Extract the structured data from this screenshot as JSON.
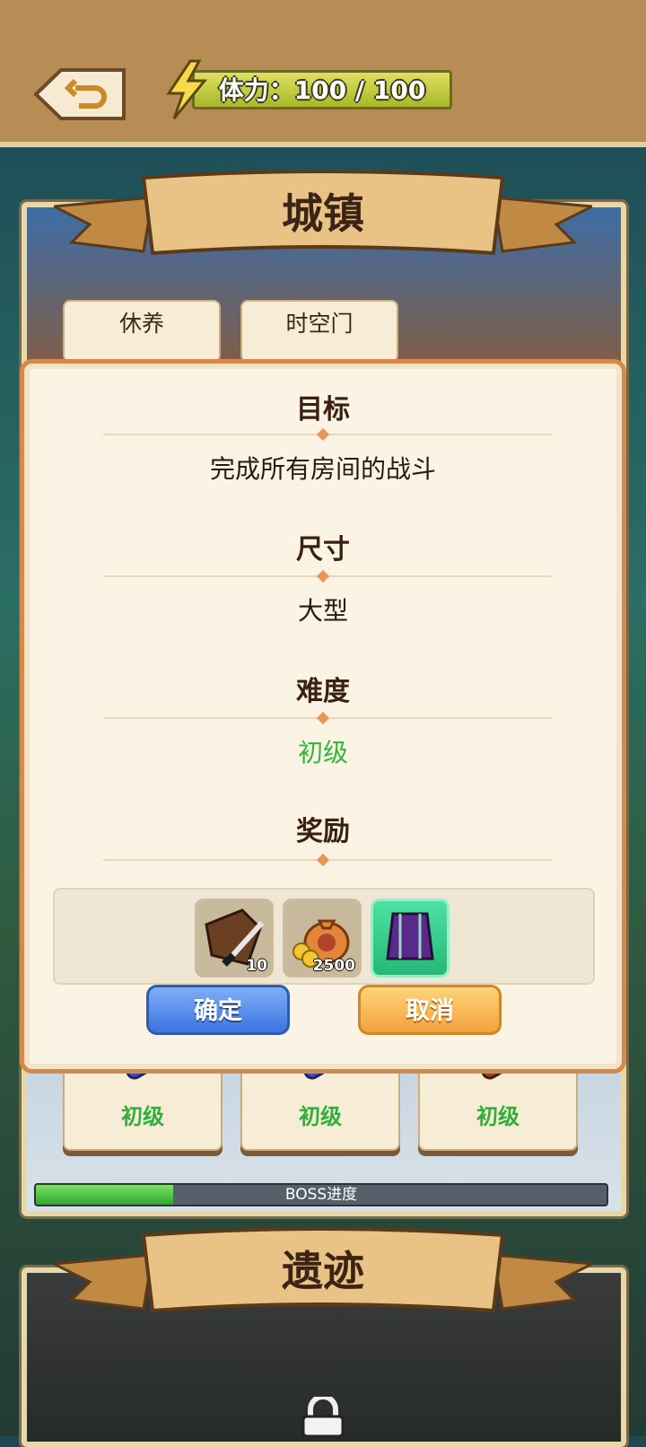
{
  "top_bar": {
    "energy_text": "体力：100 / 100",
    "back_icon": "return-arrow-icon",
    "energy_icon": "lightning-icon"
  },
  "town": {
    "title": "城镇",
    "tabs": [
      "休养",
      "时空门"
    ],
    "levels": [
      "初级",
      "初级",
      "初级"
    ],
    "boss_label": "BOSS进度",
    "boss_progress": 0.24
  },
  "ruins": {
    "title": "遗迹",
    "lock_icon": "lock-icon"
  },
  "dialog": {
    "goal_title": "目标",
    "goal_value": "完成所有房间的战斗",
    "size_title": "尺寸",
    "size_value": "大型",
    "difficulty_title": "难度",
    "difficulty_value": "初级",
    "reward_title": "奖励",
    "rewards": [
      {
        "icon": "leather-knife-icon",
        "count": "10"
      },
      {
        "icon": "money-bag-icon",
        "count": "2500"
      },
      {
        "icon": "purple-robe-icon",
        "count": ""
      }
    ],
    "confirm_label": "确定",
    "cancel_label": "取消"
  },
  "colors": {
    "accent_green": "#2fb83a",
    "dialog_border": "#d38a4a"
  }
}
